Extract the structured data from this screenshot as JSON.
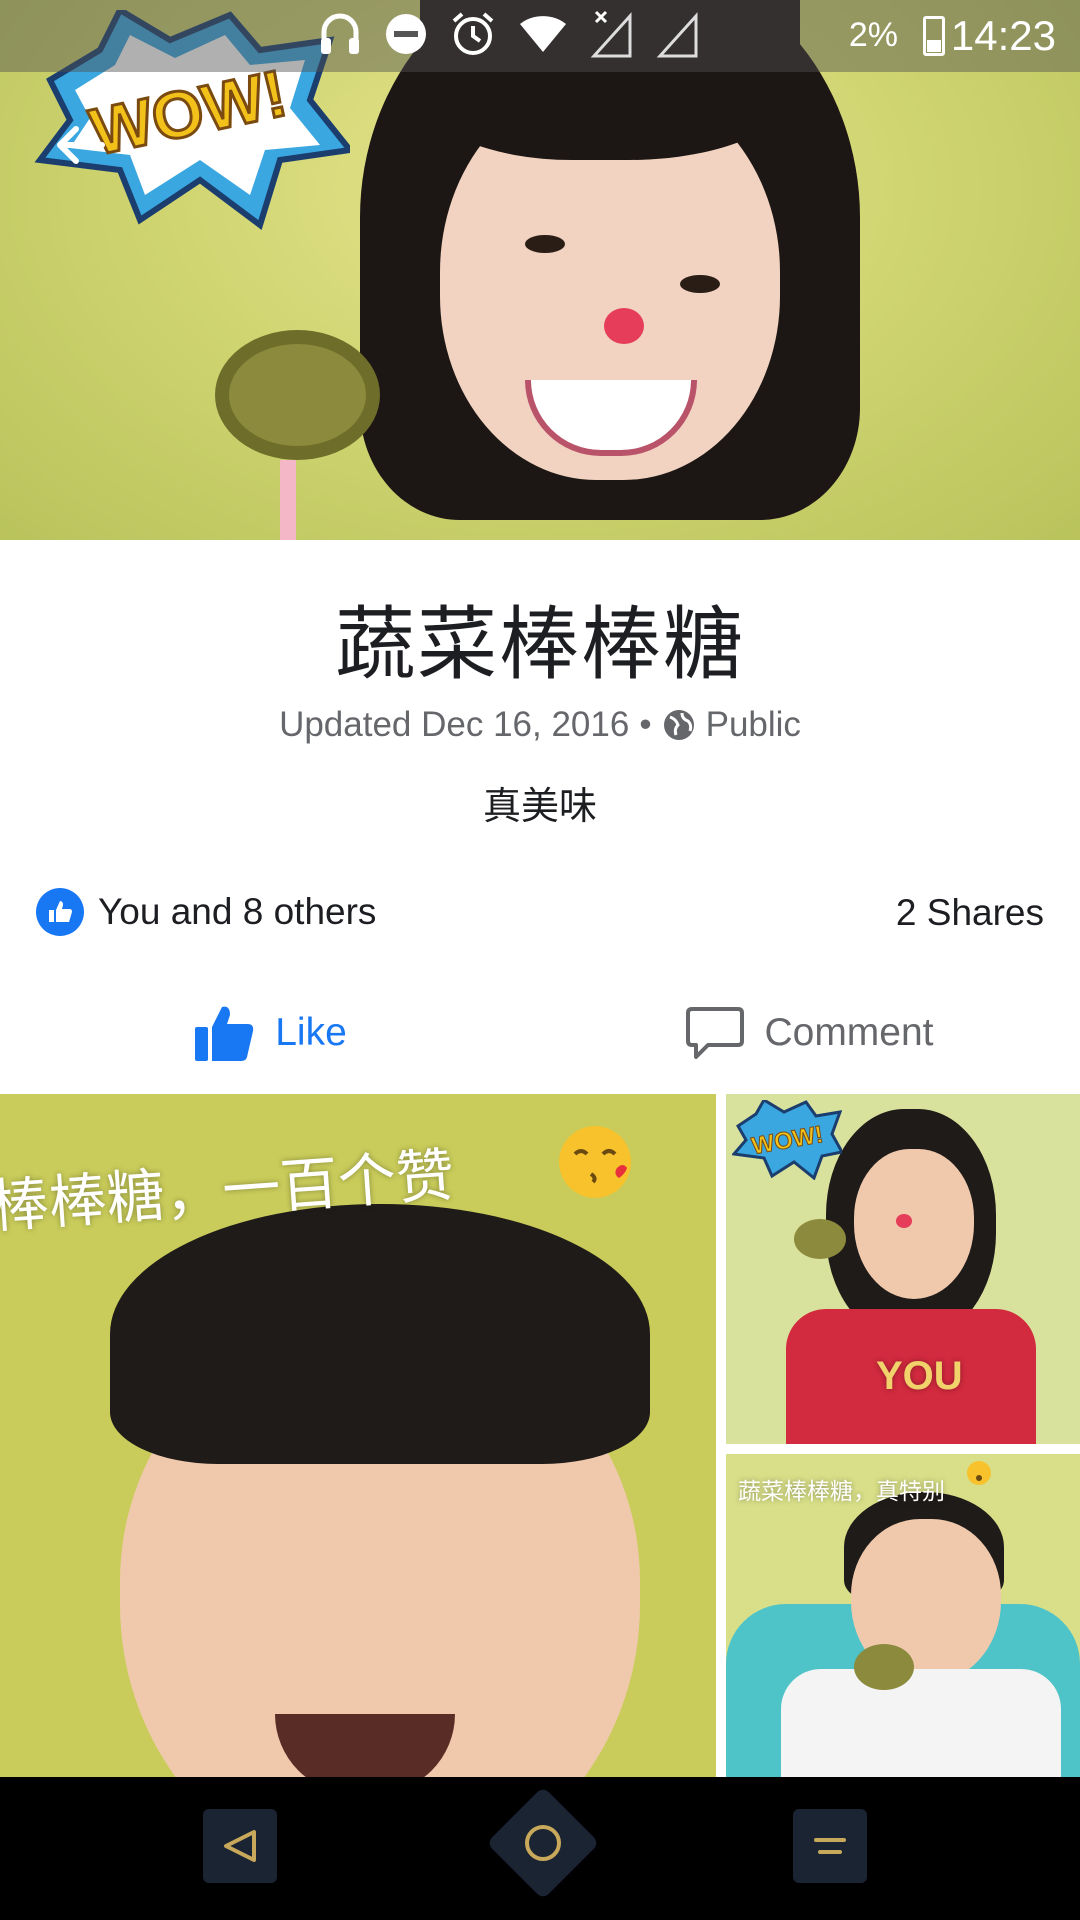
{
  "status_bar": {
    "battery_percent": "2%",
    "time": "14:23",
    "icons": [
      "headphones-icon",
      "do-not-disturb-icon",
      "alarm-icon",
      "wifi-icon",
      "no-signal-icon",
      "signal-icon",
      "battery-icon"
    ]
  },
  "cover": {
    "sticker_text": "WOW!"
  },
  "album": {
    "title": "蔬菜棒棒糖",
    "updated": "Updated Dec 16, 2016",
    "separator": "•",
    "privacy": "Public",
    "description": "真美味"
  },
  "reactions": {
    "summary": "You and 8 others",
    "shares": "2 Shares"
  },
  "actions": {
    "like_label": "Like",
    "comment_label": "Comment"
  },
  "photos": {
    "big_caption": "棒棒糖，一百个赞",
    "small1_sticker": "WOW!",
    "small1_shirt": "YOU",
    "small2_caption": "蔬菜棒棒糖，真特别"
  },
  "colors": {
    "accent": "#1877f2",
    "text_primary": "#1c1e21",
    "text_secondary": "#65676b",
    "nav_button_icon": "#c8a85a"
  }
}
